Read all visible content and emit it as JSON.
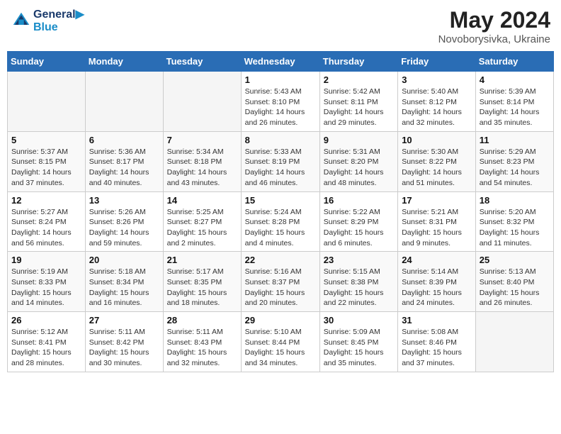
{
  "header": {
    "logo_line1": "General",
    "logo_line2": "Blue",
    "month_year": "May 2024",
    "location": "Novoborysivka, Ukraine"
  },
  "weekdays": [
    "Sunday",
    "Monday",
    "Tuesday",
    "Wednesday",
    "Thursday",
    "Friday",
    "Saturday"
  ],
  "weeks": [
    [
      {
        "day": "",
        "empty": true
      },
      {
        "day": "",
        "empty": true
      },
      {
        "day": "",
        "empty": true
      },
      {
        "day": "1",
        "info": "Sunrise: 5:43 AM\nSunset: 8:10 PM\nDaylight: 14 hours\nand 26 minutes."
      },
      {
        "day": "2",
        "info": "Sunrise: 5:42 AM\nSunset: 8:11 PM\nDaylight: 14 hours\nand 29 minutes."
      },
      {
        "day": "3",
        "info": "Sunrise: 5:40 AM\nSunset: 8:12 PM\nDaylight: 14 hours\nand 32 minutes."
      },
      {
        "day": "4",
        "info": "Sunrise: 5:39 AM\nSunset: 8:14 PM\nDaylight: 14 hours\nand 35 minutes."
      }
    ],
    [
      {
        "day": "5",
        "info": "Sunrise: 5:37 AM\nSunset: 8:15 PM\nDaylight: 14 hours\nand 37 minutes."
      },
      {
        "day": "6",
        "info": "Sunrise: 5:36 AM\nSunset: 8:17 PM\nDaylight: 14 hours\nand 40 minutes."
      },
      {
        "day": "7",
        "info": "Sunrise: 5:34 AM\nSunset: 8:18 PM\nDaylight: 14 hours\nand 43 minutes."
      },
      {
        "day": "8",
        "info": "Sunrise: 5:33 AM\nSunset: 8:19 PM\nDaylight: 14 hours\nand 46 minutes."
      },
      {
        "day": "9",
        "info": "Sunrise: 5:31 AM\nSunset: 8:20 PM\nDaylight: 14 hours\nand 48 minutes."
      },
      {
        "day": "10",
        "info": "Sunrise: 5:30 AM\nSunset: 8:22 PM\nDaylight: 14 hours\nand 51 minutes."
      },
      {
        "day": "11",
        "info": "Sunrise: 5:29 AM\nSunset: 8:23 PM\nDaylight: 14 hours\nand 54 minutes."
      }
    ],
    [
      {
        "day": "12",
        "info": "Sunrise: 5:27 AM\nSunset: 8:24 PM\nDaylight: 14 hours\nand 56 minutes."
      },
      {
        "day": "13",
        "info": "Sunrise: 5:26 AM\nSunset: 8:26 PM\nDaylight: 14 hours\nand 59 minutes."
      },
      {
        "day": "14",
        "info": "Sunrise: 5:25 AM\nSunset: 8:27 PM\nDaylight: 15 hours\nand 2 minutes."
      },
      {
        "day": "15",
        "info": "Sunrise: 5:24 AM\nSunset: 8:28 PM\nDaylight: 15 hours\nand 4 minutes."
      },
      {
        "day": "16",
        "info": "Sunrise: 5:22 AM\nSunset: 8:29 PM\nDaylight: 15 hours\nand 6 minutes."
      },
      {
        "day": "17",
        "info": "Sunrise: 5:21 AM\nSunset: 8:31 PM\nDaylight: 15 hours\nand 9 minutes."
      },
      {
        "day": "18",
        "info": "Sunrise: 5:20 AM\nSunset: 8:32 PM\nDaylight: 15 hours\nand 11 minutes."
      }
    ],
    [
      {
        "day": "19",
        "info": "Sunrise: 5:19 AM\nSunset: 8:33 PM\nDaylight: 15 hours\nand 14 minutes."
      },
      {
        "day": "20",
        "info": "Sunrise: 5:18 AM\nSunset: 8:34 PM\nDaylight: 15 hours\nand 16 minutes."
      },
      {
        "day": "21",
        "info": "Sunrise: 5:17 AM\nSunset: 8:35 PM\nDaylight: 15 hours\nand 18 minutes."
      },
      {
        "day": "22",
        "info": "Sunrise: 5:16 AM\nSunset: 8:37 PM\nDaylight: 15 hours\nand 20 minutes."
      },
      {
        "day": "23",
        "info": "Sunrise: 5:15 AM\nSunset: 8:38 PM\nDaylight: 15 hours\nand 22 minutes."
      },
      {
        "day": "24",
        "info": "Sunrise: 5:14 AM\nSunset: 8:39 PM\nDaylight: 15 hours\nand 24 minutes."
      },
      {
        "day": "25",
        "info": "Sunrise: 5:13 AM\nSunset: 8:40 PM\nDaylight: 15 hours\nand 26 minutes."
      }
    ],
    [
      {
        "day": "26",
        "info": "Sunrise: 5:12 AM\nSunset: 8:41 PM\nDaylight: 15 hours\nand 28 minutes."
      },
      {
        "day": "27",
        "info": "Sunrise: 5:11 AM\nSunset: 8:42 PM\nDaylight: 15 hours\nand 30 minutes."
      },
      {
        "day": "28",
        "info": "Sunrise: 5:11 AM\nSunset: 8:43 PM\nDaylight: 15 hours\nand 32 minutes."
      },
      {
        "day": "29",
        "info": "Sunrise: 5:10 AM\nSunset: 8:44 PM\nDaylight: 15 hours\nand 34 minutes."
      },
      {
        "day": "30",
        "info": "Sunrise: 5:09 AM\nSunset: 8:45 PM\nDaylight: 15 hours\nand 35 minutes."
      },
      {
        "day": "31",
        "info": "Sunrise: 5:08 AM\nSunset: 8:46 PM\nDaylight: 15 hours\nand 37 minutes."
      },
      {
        "day": "",
        "empty": true
      }
    ]
  ]
}
